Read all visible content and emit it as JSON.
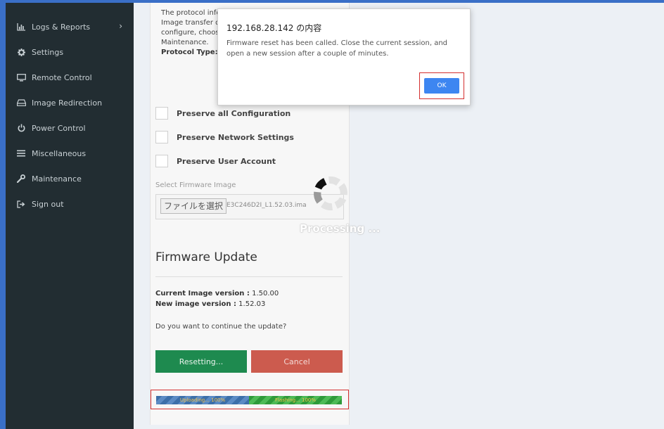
{
  "sidebar": {
    "items": [
      {
        "label": "Logs & Reports",
        "icon": "bar-chart-icon",
        "has_submenu": true
      },
      {
        "label": "Settings",
        "icon": "gear-icon"
      },
      {
        "label": "Remote Control",
        "icon": "monitor-icon"
      },
      {
        "label": "Image Redirection",
        "icon": "drive-icon"
      },
      {
        "label": "Power Control",
        "icon": "power-icon"
      },
      {
        "label": "Miscellaneous",
        "icon": "menu-icon"
      },
      {
        "label": "Maintenance",
        "icon": "wrench-icon"
      },
      {
        "label": "Sign out",
        "icon": "sign-out-icon"
      }
    ],
    "submenu_chevron": "›"
  },
  "main": {
    "info_lines": [
      "The protocol info",
      "Image transfer d",
      "configure, choos",
      "Maintenance."
    ],
    "protocol_type_label": "Protocol Type:",
    "preserve_options": [
      {
        "label": "Preserve all Configuration",
        "checked": false
      },
      {
        "label": "Preserve Network Settings",
        "checked": false
      },
      {
        "label": "Preserve User Account",
        "checked": false
      }
    ],
    "select_firmware_label": "Select Firmware Image",
    "file_button_label": "ファイルを選択",
    "file_name": "E3C246D2I_L1.52.03.ima",
    "processing_text": "Processing ...",
    "firmware_update_title": "Firmware Update",
    "current_version_label": "Current Image version :",
    "current_version_value": "1.50.00",
    "new_version_label": "New image version :",
    "new_version_value": "1.52.03",
    "question": "Do you want to continue the update?",
    "resetting_button": "Resetting...",
    "cancel_button": "Cancel",
    "progress": {
      "upload_label": "Uploading... 100%",
      "upload_percent": 100,
      "flash_label": "Flashing... 100%",
      "flash_percent": 100
    }
  },
  "dialog": {
    "title": "192.168.28.142 の内容",
    "message": "Firmware reset has been called. Close the current session, and open a new session after a couple of minutes.",
    "ok_label": "OK"
  },
  "colors": {
    "sidebar_bg": "#222d32",
    "reset_green": "#1e8a4f",
    "cancel_red": "#cc5b4e",
    "ok_blue": "#3d86f1",
    "highlight_red": "#d32f2f"
  }
}
